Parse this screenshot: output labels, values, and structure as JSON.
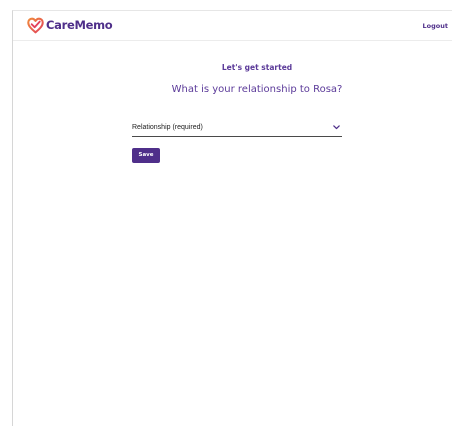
{
  "header": {
    "brand": "CareMemo",
    "logout_label": "Logout"
  },
  "main": {
    "heading": "Let's get started",
    "question": "What is your relationship to Rosa?",
    "relationship_select": {
      "selected_value": "Relationship (required)"
    },
    "save_label": "Save"
  },
  "icons": {
    "logo": "heart-check-logo-icon",
    "select_arrow": "chevron-down-icon"
  },
  "colors": {
    "brand_purple": "#4f2f8a",
    "heading_purple": "#5b3a99",
    "logo_red": "#e2415b",
    "logo_orange": "#f08a3c"
  }
}
